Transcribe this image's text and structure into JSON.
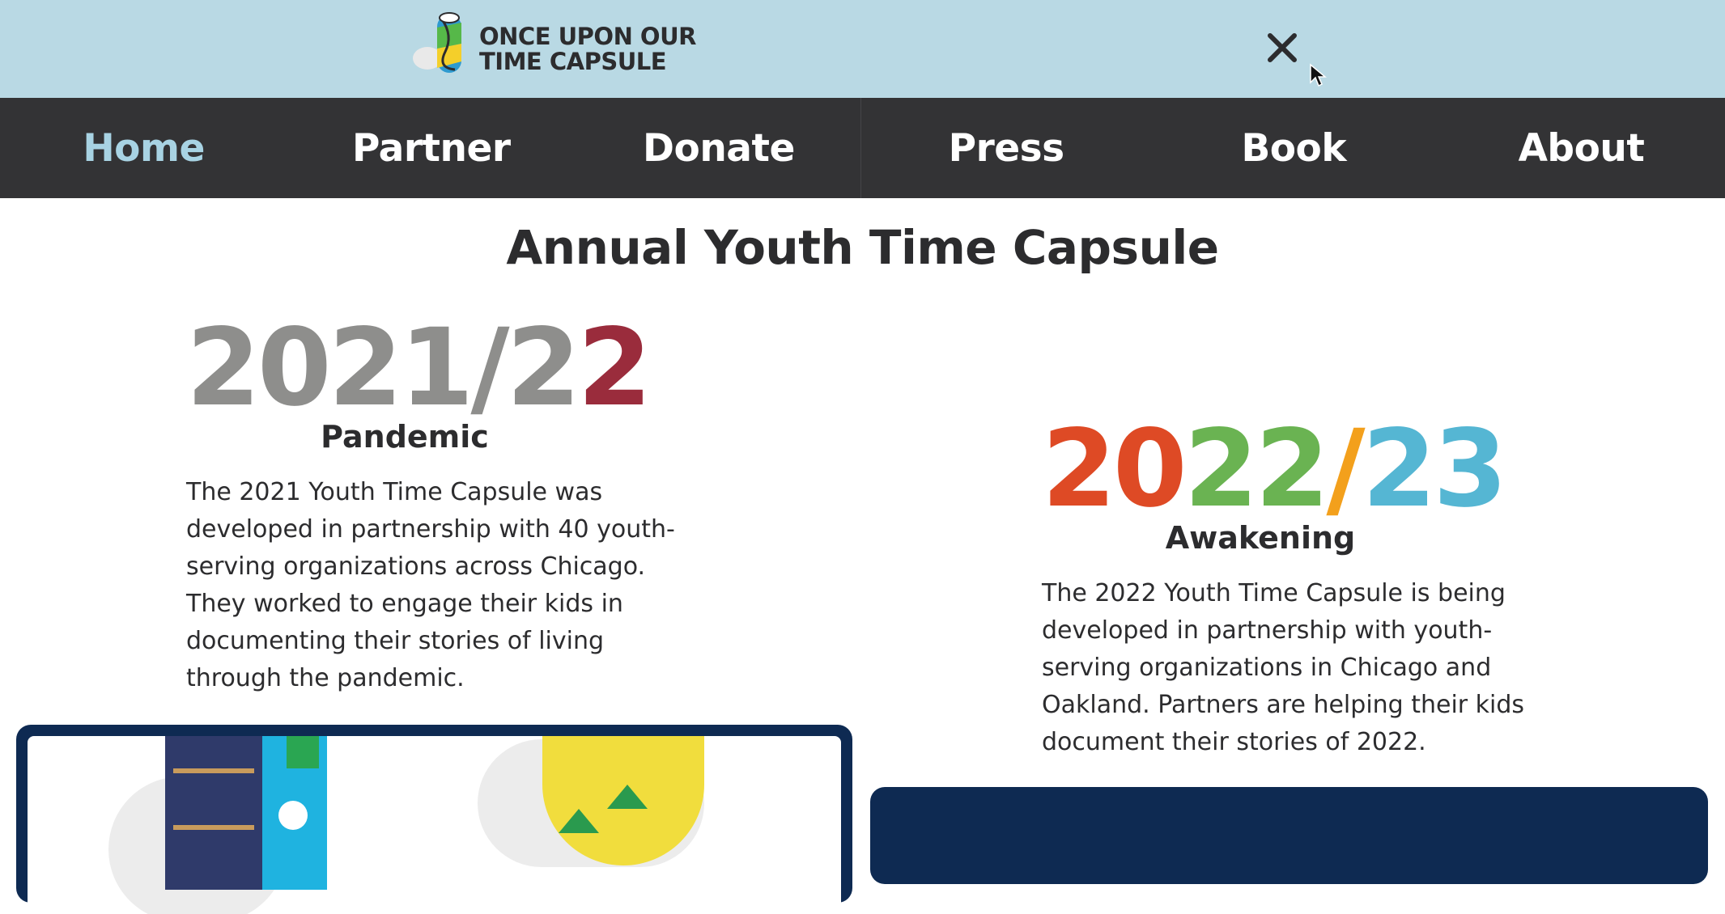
{
  "banner": {
    "logo_text": "ONCE UPON OUR\nTIME CAPSULE",
    "close_icon": "close-icon"
  },
  "nav": {
    "items": [
      {
        "label": "Home",
        "active": true
      },
      {
        "label": "Partner",
        "active": false
      },
      {
        "label": "Donate",
        "active": false
      },
      {
        "label": "Press",
        "active": false
      },
      {
        "label": "Book",
        "active": false
      },
      {
        "label": "About",
        "active": false
      }
    ]
  },
  "main": {
    "title": "Annual Youth Time Capsule",
    "capsules": [
      {
        "year_parts": [
          "2021/2",
          "2"
        ],
        "theme": "Pandemic",
        "description": "The 2021 Youth Time Capsule was developed in partnership with 40 youth-serving organizations across Chicago. They worked to engage their kids in documenting their stories of living through the pandemic."
      },
      {
        "year_parts": [
          "20",
          "22",
          "/",
          "23"
        ],
        "theme": "Awakening",
        "description": "The 2022 Youth Time Capsule is being developed in partnership with youth-serving organizations in Chicago and Oakland. Partners are helping their kids document their stories of 2022."
      }
    ]
  },
  "colors": {
    "banner_bg": "#b9d9e4",
    "nav_bg": "#333335",
    "nav_active": "#a8d3e3",
    "card_navy": "#0e2a52",
    "year_red": "#de4a25",
    "year_green": "#6ab352",
    "year_orange": "#f3a01c",
    "year_blue": "#55b6d3",
    "year_gray": "#8e8e8c"
  }
}
